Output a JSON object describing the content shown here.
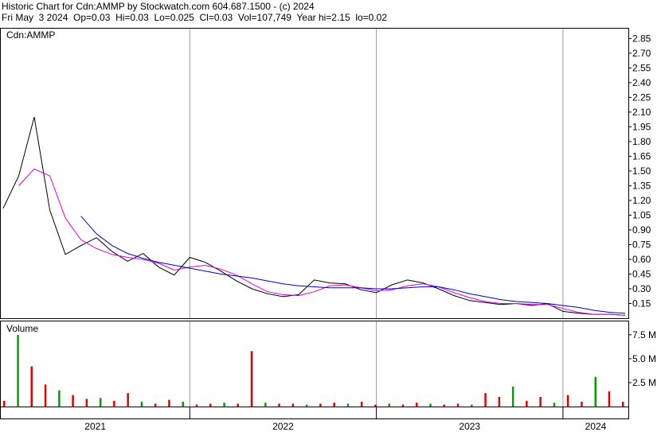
{
  "header": {
    "line1": "Historic Chart for Cdn:AMMP by Stockwatch.com 604.687.1500 - (c) 2024",
    "line2": "Fri May  3 2024  Op=0.03  Hi=0.03  Lo=0.025  Cl=0.03  Vol=107,749  Year hi=2.15  lo=0.02"
  },
  "colors": {
    "price": "#000000",
    "ma_short": "#e000e0",
    "ma_long": "#0000cc",
    "vol_up": "#00a000",
    "vol_down": "#e00000",
    "grid": "#9a9a9a"
  },
  "chart_data": [
    {
      "type": "line",
      "title": "Cdn:AMMP",
      "ylim": [
        0,
        2.95
      ],
      "yticks": [
        "0.15",
        "0.30",
        "0.45",
        "0.60",
        "0.75",
        "0.90",
        "1.05",
        "1.20",
        "1.35",
        "1.50",
        "1.65",
        "1.80",
        "1.95",
        "2.10",
        "2.25",
        "2.40",
        "2.55",
        "2.70",
        "2.85"
      ],
      "x": [
        "2021-01",
        "2021-02",
        "2021-03",
        "2021-04",
        "2021-05",
        "2021-06",
        "2021-07",
        "2021-08",
        "2021-09",
        "2021-10",
        "2021-11",
        "2021-12",
        "2022-01",
        "2022-02",
        "2022-03",
        "2022-04",
        "2022-05",
        "2022-06",
        "2022-07",
        "2022-08",
        "2022-09",
        "2022-10",
        "2022-11",
        "2022-12",
        "2023-01",
        "2023-02",
        "2023-03",
        "2023-04",
        "2023-05",
        "2023-06",
        "2023-07",
        "2023-08",
        "2023-09",
        "2023-10",
        "2023-11",
        "2023-12",
        "2024-01",
        "2024-02",
        "2024-03",
        "2024-04",
        "2024-05"
      ],
      "series": [
        {
          "name": "price",
          "values": [
            1.12,
            1.45,
            2.05,
            1.1,
            0.65,
            0.74,
            0.82,
            0.68,
            0.58,
            0.66,
            0.52,
            0.44,
            0.62,
            0.57,
            0.48,
            0.38,
            0.3,
            0.25,
            0.22,
            0.24,
            0.39,
            0.36,
            0.35,
            0.29,
            0.26,
            0.34,
            0.39,
            0.36,
            0.3,
            0.23,
            0.18,
            0.16,
            0.14,
            0.15,
            0.13,
            0.15,
            0.07,
            0.05,
            0.04,
            0.04,
            0.03
          ]
        },
        {
          "name": "ma_short",
          "values": [
            null,
            1.35,
            1.52,
            1.45,
            1.02,
            0.8,
            0.71,
            0.65,
            0.62,
            0.6,
            0.56,
            0.49,
            0.52,
            0.54,
            0.5,
            0.44,
            0.35,
            0.27,
            0.24,
            0.23,
            0.27,
            0.33,
            0.34,
            0.31,
            0.28,
            0.29,
            0.33,
            0.35,
            0.32,
            0.26,
            0.21,
            0.17,
            0.15,
            0.15,
            0.14,
            0.14,
            0.1,
            0.06,
            0.04,
            0.04,
            0.03
          ]
        },
        {
          "name": "ma_long",
          "values": [
            null,
            null,
            null,
            null,
            null,
            1.04,
            0.86,
            0.74,
            0.66,
            0.61,
            0.57,
            0.54,
            0.51,
            0.48,
            0.45,
            0.43,
            0.41,
            0.38,
            0.35,
            0.33,
            0.32,
            0.31,
            0.31,
            0.31,
            0.3,
            0.3,
            0.31,
            0.32,
            0.32,
            0.29,
            0.25,
            0.22,
            0.19,
            0.17,
            0.16,
            0.15,
            0.13,
            0.11,
            0.08,
            0.06,
            0.05
          ]
        }
      ]
    },
    {
      "type": "bar",
      "title": "Volume",
      "ylim": [
        0,
        8.9
      ],
      "yticks": [
        "2.5 M",
        "5.0 M",
        "7.5 M"
      ],
      "x_axis_labels": [
        "2021",
        "2022",
        "2023",
        "2024"
      ],
      "values_millions": [
        0.6,
        8.6,
        4.2,
        2.3,
        1.7,
        1.2,
        0.8,
        0.9,
        0.6,
        1.4,
        0.5,
        0.3,
        0.7,
        0.5,
        0.2,
        0.3,
        0.4,
        0.3,
        5.8,
        0.4,
        0.3,
        0.3,
        0.2,
        0.3,
        0.4,
        0.3,
        0.5,
        0.2,
        0.3,
        0.2,
        0.4,
        0.3,
        0.2,
        0.3,
        0.2,
        1.4,
        1.0,
        2.1,
        0.6,
        1.0,
        0.4,
        1.2,
        0.5,
        3.1,
        1.6,
        0.5
      ]
    }
  ]
}
